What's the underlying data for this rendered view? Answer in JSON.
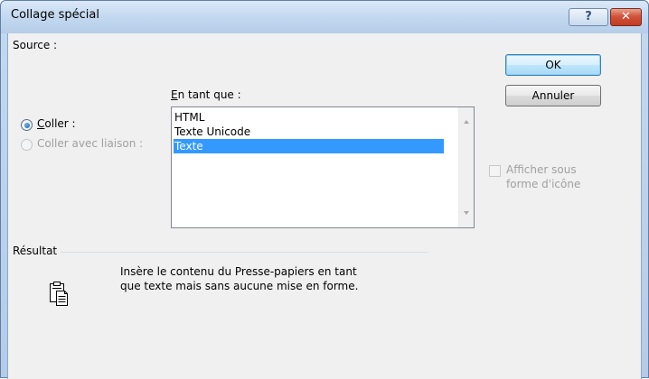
{
  "window": {
    "title": "Collage spécial",
    "help_label": "?",
    "close_label": "✕"
  },
  "source": {
    "label": "Source :"
  },
  "buttons": {
    "ok": "OK",
    "cancel": "Annuler"
  },
  "as_label": {
    "first": "E",
    "rest": "n tant que :"
  },
  "paste_options": {
    "paste": {
      "first": "C",
      "rest": "oller :",
      "checked": true
    },
    "paste_link": {
      "label": "Coller avec liaison :",
      "checked": false,
      "disabled": true
    }
  },
  "format_list": {
    "items": [
      "HTML",
      "Texte Unicode",
      "Texte"
    ],
    "selected_index": 2
  },
  "display_as_icon": {
    "line1": "Afficher sous",
    "line2": "forme d'icône",
    "checked": false,
    "disabled": true
  },
  "result": {
    "label": "Résultat",
    "line1": "Insère le contenu du Presse-papiers en tant",
    "line2": "que texte mais sans aucune mise en forme.",
    "icon": "clipboard-text-icon"
  },
  "colors": {
    "selection": "#3399ff",
    "close_button": "#c23b22",
    "dialog_background": "#f0f0f0"
  }
}
